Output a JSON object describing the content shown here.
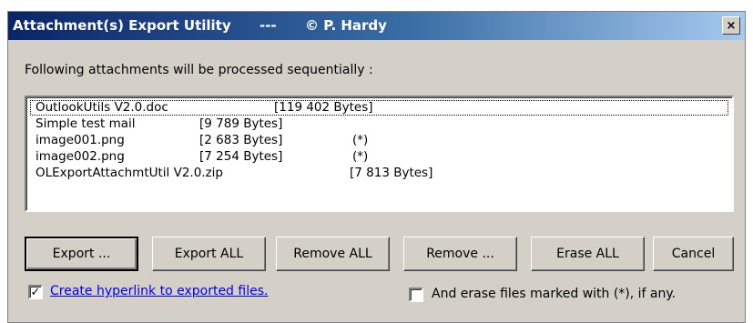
{
  "window": {
    "title": "Attachment(s) Export Utility      ---      © P. Hardy",
    "close_symbol": "×"
  },
  "intro_text": "Following attachments will be processed sequentially :",
  "attachments": [
    {
      "name": "OutlookUtils V2.0.doc",
      "size": "[119 402 Bytes]",
      "flag": ""
    },
    {
      "name": "Simple test mail",
      "size": "[9 789 Bytes]",
      "flag": ""
    },
    {
      "name": "image001.png",
      "size": "[2 683 Bytes]",
      "flag": "(*)"
    },
    {
      "name": "image002.png",
      "size": "[7 254 Bytes]",
      "flag": "(*)"
    },
    {
      "name": "OLExportAttachmtUtil V2.0.zip",
      "size": "[7 813 Bytes]",
      "flag": ""
    }
  ],
  "buttons": {
    "export": "Export ...",
    "export_all": "Export ALL",
    "remove_all": "Remove ALL",
    "remove": "Remove ...",
    "erase_all": "Erase ALL",
    "cancel": "Cancel"
  },
  "options": {
    "hyperlink_label": "Create hyperlink to exported files.",
    "hyperlink_checked": true,
    "hyperlink_mark": "✓",
    "erase_label": "And erase files marked with (*), if any.",
    "erase_checked": false
  }
}
